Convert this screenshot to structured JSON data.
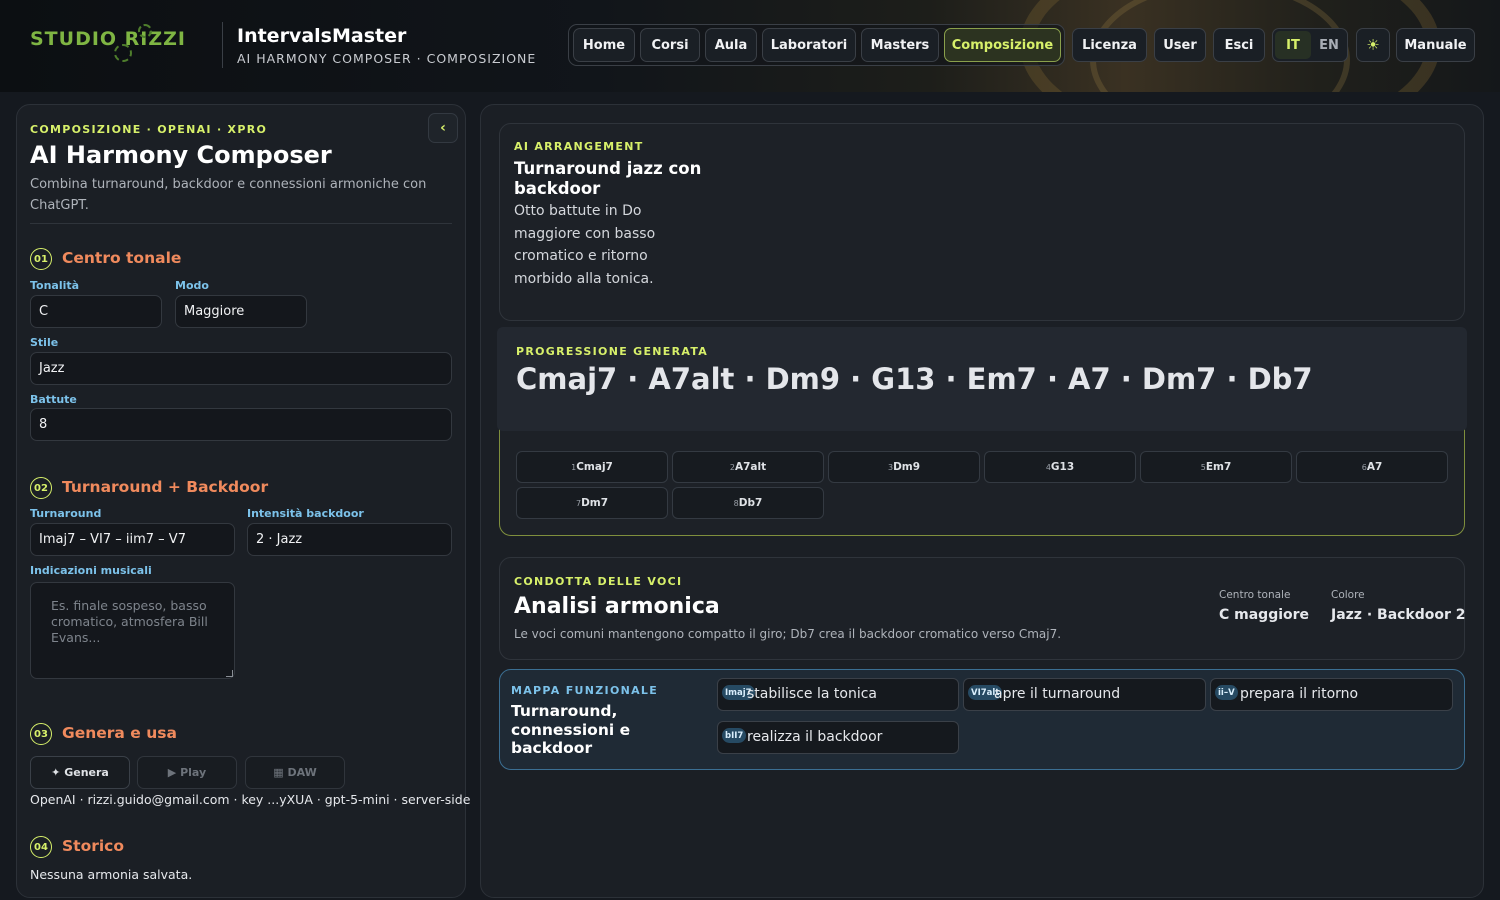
{
  "header": {
    "logo_text": "STUDIO RIZZI",
    "app_title": "IntervalsMaster",
    "app_subtitle": "AI HARMONY COMPOSER · COMPOSIZIONE",
    "nav": [
      "Home",
      "Corsi",
      "Aula",
      "Laboratori",
      "Masters",
      "Composizione"
    ],
    "nav_active": "Composizione",
    "license": "Licenza",
    "user": "User",
    "logout": "Esci",
    "lang_active": "IT",
    "lang_other": "EN",
    "theme_icon": "☀",
    "manual": "Manuale",
    "accent_color": "#d7f06a"
  },
  "left": {
    "eyebrow": "COMPOSIZIONE · OPENAI · XPRO",
    "collapse_icon": "‹",
    "title": "AI Harmony Composer",
    "description": "Combina turnaround, backdoor e connessioni armoniche con ChatGPT.",
    "s1": {
      "num": "01",
      "title": "Centro tonale",
      "key_label": "Tonalità",
      "key_value": "C",
      "mode_label": "Modo",
      "mode_value": "Maggiore",
      "style_label": "Stile",
      "style_value": "Jazz",
      "bars_label": "Battute",
      "bars_value": "8"
    },
    "s2": {
      "num": "02",
      "title": "Turnaround + Backdoor",
      "turn_label": "Turnaround",
      "turn_value": "Imaj7 – VI7 – iim7 – V7",
      "int_label": "Intensità backdoor",
      "int_value": "2 · Jazz",
      "notes_label": "Indicazioni musicali",
      "notes_placeholder": "Es. finale sospeso, basso cromatico, atmosfera Bill Evans..."
    },
    "s3": {
      "num": "03",
      "title": "Genera e usa",
      "generate": "✦ Genera",
      "play": "▶ Play",
      "daw": "▦ DAW",
      "meta": "OpenAI · rizzi.guido@gmail.com · key ...yXUA · gpt-5-mini · server-side"
    },
    "s4": {
      "num": "04",
      "title": "Storico",
      "empty": "Nessuna armonia salvata."
    }
  },
  "arrangement": {
    "eyebrow": "AI ARRANGEMENT",
    "title": "Turnaround jazz con backdoor",
    "description": "Otto battute in Do maggiore con basso cromatico e ritorno morbido alla tonica."
  },
  "progression": {
    "eyebrow": "PROGRESSIONE GENERATA",
    "chords_line": "Cmaj7 · A7alt · Dm9 · G13 · Em7 · A7 · Dm7 · Db7",
    "chips": [
      {
        "n": "1",
        "chord": "Cmaj7"
      },
      {
        "n": "2",
        "chord": "A7alt"
      },
      {
        "n": "3",
        "chord": "Dm9"
      },
      {
        "n": "4",
        "chord": "G13"
      },
      {
        "n": "5",
        "chord": "Em7"
      },
      {
        "n": "6",
        "chord": "A7"
      },
      {
        "n": "7",
        "chord": "Dm7"
      },
      {
        "n": "8",
        "chord": "Db7"
      }
    ]
  },
  "analysis": {
    "eyebrow": "CONDOTTA DELLE VOCI",
    "title": "Analisi armonica",
    "description": "Le voci comuni mantengono compatto il giro; Db7 crea il backdoor cromatico verso Cmaj7.",
    "center_label": "Centro tonale",
    "center_value": "C maggiore",
    "color_label": "Colore",
    "color_value": "Jazz · Backdoor 2"
  },
  "function_map": {
    "eyebrow": "MAPPA FUNZIONALE",
    "title": "Turnaround, connessioni e backdoor",
    "items": [
      {
        "tag": "Imaj7",
        "text": "stabilisce la tonica"
      },
      {
        "tag": "VI7alt",
        "text": "apre il turnaround"
      },
      {
        "tag": "ii–V",
        "text": "prepara il ritorno"
      },
      {
        "tag": "bII7",
        "text": "realizza il backdoor"
      }
    ]
  }
}
